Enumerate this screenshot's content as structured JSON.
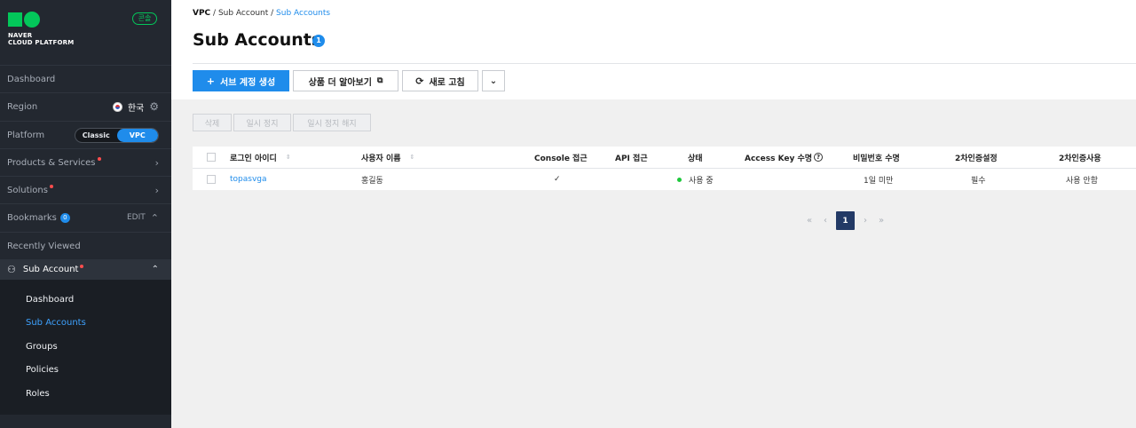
{
  "brand": {
    "logo_line1": "NAVER",
    "logo_line2": "CLOUD PLATFORM",
    "badge": "콘솔"
  },
  "sidebar": {
    "dashboard": "Dashboard",
    "region_label": "Region",
    "region_value": "한국",
    "platform_label": "Platform",
    "platform_options": [
      "Classic",
      "VPC"
    ],
    "platform_selected": "VPC",
    "products": "Products & Services",
    "solutions": "Solutions",
    "bookmarks": "Bookmarks",
    "bookmarks_count": "0",
    "bookmarks_edit": "EDIT",
    "recently_viewed": "Recently Viewed",
    "sub_account": "Sub Account",
    "submenu": [
      "Dashboard",
      "Sub Accounts",
      "Groups",
      "Policies",
      "Roles"
    ],
    "submenu_active": "Sub Accounts"
  },
  "breadcrumb": [
    "VPC",
    "Sub Account",
    "Sub Accounts"
  ],
  "page": {
    "title": "Sub Accounts",
    "count": "1"
  },
  "toolbar": {
    "create": "서브 계정 생성",
    "learn_more": "상품 더 알아보기",
    "refresh": "새로 고침"
  },
  "subtoolbar": {
    "delete": "삭제",
    "pause": "일시 정지",
    "unpause": "일시 정지 해지"
  },
  "table": {
    "columns": [
      "로그인 아이디",
      "사용자 이름",
      "Console 접근",
      "API 접근",
      "상태",
      "Access Key 수명",
      "비밀번호 수명",
      "2차인증설정",
      "2차인증사용"
    ],
    "rows": [
      {
        "login_id": "topasvga",
        "user_name": "홍길동",
        "console": "✓",
        "api": "",
        "status": "사용 중",
        "access_key": "",
        "password": "1일 미만",
        "mfa_setting": "필수",
        "mfa_use": "사용 안함"
      }
    ]
  },
  "pagination": {
    "current": "1"
  },
  "colors": {
    "accent": "#1f8ceb",
    "brand_green": "#03c75a",
    "sidebar_bg": "#232830",
    "status_active": "#1ec83c",
    "pager_active": "#233a66"
  }
}
